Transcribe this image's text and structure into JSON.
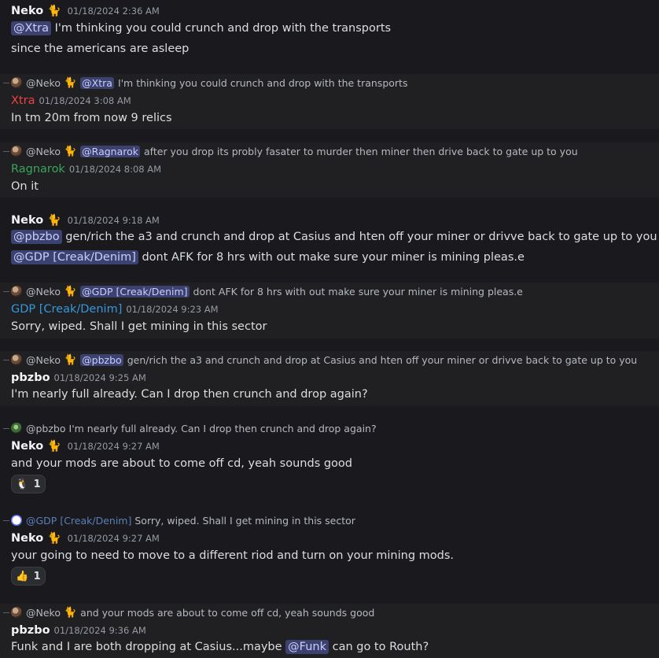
{
  "messages": {
    "m1": {
      "author": "Neko",
      "time": "01/18/2024 2:36 AM",
      "mention": "@Xtra",
      "text1": "I'm thinking you could crunch and drop with the transports",
      "text2": "since the americans are asleep"
    },
    "m2": {
      "reply_author": "@Neko",
      "reply_mention": "@Xtra",
      "reply_text": "I'm thinking you could crunch and drop with the transports",
      "author": "Xtra",
      "time": "01/18/2024 3:08 AM",
      "text": "In tm 20m from now 9 relics"
    },
    "m3": {
      "reply_author": "@Neko",
      "reply_mention": "@Ragnarok",
      "reply_text": "after you drop its probly fasater to murder then miner then drive back to gate up to you",
      "author": "Ragnarok",
      "time": "01/18/2024 8:08 AM",
      "text": "On it"
    },
    "m4": {
      "author": "Neko",
      "time": "01/18/2024 9:18 AM",
      "mention1": "@pbzbo",
      "text1": "gen/rich the a3 and crunch and drop at Casius and hten off your miner or drivve back to gate up to you",
      "mention2": "@GDP [Creak/Denim]",
      "text2": "dont AFK for 8 hrs with out make sure your miner is mining pleas.e"
    },
    "m5": {
      "reply_author": "@Neko",
      "reply_mention": "@GDP [Creak/Denim]",
      "reply_text": "dont AFK for 8 hrs with out make sure your miner is mining pleas.e",
      "author": "GDP [Creak/Denim]",
      "time": "01/18/2024 9:23 AM",
      "text": "Sorry, wiped.  Shall I get mining in this sector"
    },
    "m6": {
      "reply_author": "@Neko",
      "reply_mention": "@pbzbo",
      "reply_text": "gen/rich the a3 and crunch and drop at Casius and hten off your miner or drivve back to gate up to you",
      "author": "pbzbo",
      "time": "01/18/2024 9:25 AM",
      "text": "I'm nearly full already.  Can I drop then crunch and drop again?"
    },
    "m7": {
      "reply_author": "@pbzbo",
      "reply_text": "I'm nearly full already.  Can I drop then crunch and drop again?",
      "author": "Neko",
      "time": "01/18/2024 9:27 AM",
      "text": "and your mods are about to come off cd, yeah sounds good",
      "reaction_emoji": "🐧",
      "reaction_count": "1"
    },
    "m8": {
      "reply_author": "@GDP [Creak/Denim]",
      "reply_text": "Sorry, wiped.  Shall I get mining in this sector",
      "author": "Neko",
      "time": "01/18/2024 9:27 AM",
      "text": "your going to need to move to a different riod and turn on your mining mods.",
      "reaction_emoji": "👍",
      "reaction_count": "1"
    },
    "m9": {
      "reply_author": "@Neko",
      "reply_text": "and your mods are about to come off cd, yeah sounds good",
      "author": "pbzbo",
      "time": "01/18/2024 9:36 AM",
      "text_before": "Funk and I are both dropping at Casius...maybe",
      "mention": "@Funk",
      "text_after": "can go to Routh?"
    }
  },
  "cat_emoji": "🐈",
  "colors": {
    "background": "#1a1a1e",
    "highlight": "#201f22",
    "mention_bg": "#3c4270",
    "xtra": "#ed4245",
    "ragnarok": "#3ba55c",
    "gdp": "#3498db"
  }
}
